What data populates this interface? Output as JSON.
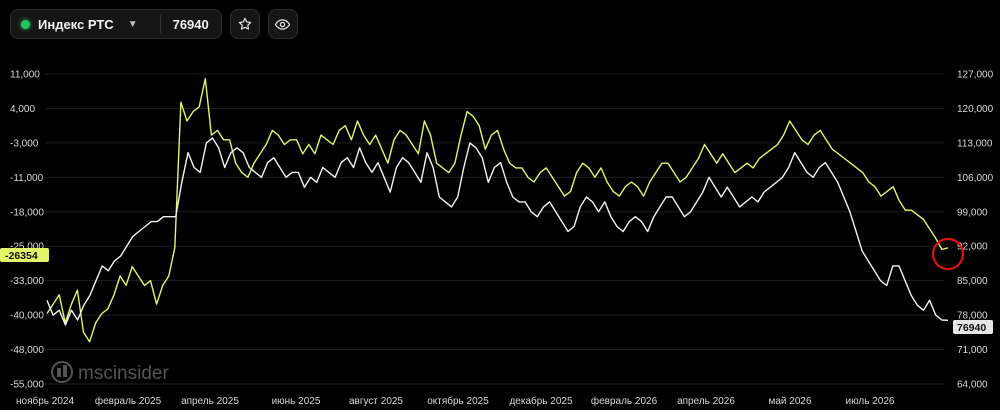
{
  "toolbar": {
    "ticker_name": "Индекс РТС",
    "ticker_value": "76940",
    "status_color": "#22c55e",
    "icons": [
      "chevron-down-icon",
      "star-icon",
      "eye-icon"
    ]
  },
  "watermark": "mscinsider",
  "chart_data": {
    "type": "line",
    "x_labels": [
      "ноябрь 2024",
      "февраль 2025",
      "апрель 2025",
      "июнь 2025",
      "август 2025",
      "октябрь 2025",
      "декабрь 2025",
      "февраль 2026",
      "апрель 2026",
      "май 2026",
      "июль 2026"
    ],
    "left_axis": {
      "ticks": [
        "11,000",
        "4,000",
        "-3,000",
        "-11,000",
        "-18,000",
        "-25,000",
        "-33,000",
        "-40,000",
        "-48,000",
        "-55,000"
      ],
      "range": [
        -55000,
        11000
      ]
    },
    "right_axis": {
      "ticks": [
        "127,000",
        "120,000",
        "113,000",
        "106,000",
        "99,000",
        "92,000",
        "85,000",
        "78,000",
        "71,000",
        "64,000"
      ],
      "range": [
        64000,
        127000
      ]
    },
    "left_badge": "-26354",
    "right_badge": "76940",
    "series": [
      {
        "color": "#e2f56b",
        "axis": "left",
        "values": [
          -40000,
          -38000,
          -36000,
          -42000,
          -38000,
          -35000,
          -44000,
          -46000,
          -42000,
          -40000,
          -39000,
          -36000,
          -32000,
          -34000,
          -30000,
          -32000,
          -34000,
          -33000,
          -38000,
          -34000,
          -32000,
          -26000,
          5000,
          1000,
          3000,
          4000,
          10000,
          -2000,
          -1000,
          -3000,
          -3000,
          -8000,
          -10000,
          -11000,
          -8000,
          -6000,
          -4000,
          -1000,
          -2000,
          -4000,
          -3000,
          -3000,
          -6000,
          -4000,
          -6000,
          -2000,
          -3000,
          -4000,
          -1000,
          0,
          -3000,
          1000,
          -2000,
          -4000,
          -2000,
          -5000,
          -8000,
          -3000,
          -1000,
          -2000,
          -4000,
          -6000,
          1000,
          -2000,
          -8000,
          -9000,
          -10000,
          -8000,
          -2000,
          3000,
          2000,
          0,
          -5000,
          -2000,
          -1000,
          -5000,
          -8000,
          -9000,
          -9000,
          -11000,
          -12000,
          -10000,
          -9000,
          -11000,
          -13000,
          -15000,
          -14000,
          -10000,
          -8000,
          -9000,
          -11000,
          -9000,
          -12000,
          -14000,
          -15000,
          -13000,
          -12000,
          -13000,
          -15000,
          -12000,
          -10000,
          -8000,
          -8000,
          -10000,
          -12000,
          -11000,
          -9000,
          -7000,
          -4000,
          -6000,
          -8000,
          -6000,
          -8000,
          -10000,
          -9000,
          -8000,
          -9000,
          -7000,
          -6000,
          -5000,
          -4000,
          -2000,
          1000,
          -1000,
          -3000,
          -4000,
          -2000,
          -1000,
          -3000,
          -5000,
          -6000,
          -7000,
          -8000,
          -9000,
          -10000,
          -12000,
          -13000,
          -15000,
          -14000,
          -13000,
          -16000,
          -18000,
          -18000,
          -19000,
          -20000,
          -22000,
          -24000,
          -26354,
          -26000
        ]
      },
      {
        "color": "#f2f2f2",
        "axis": "right",
        "values": [
          81000,
          78000,
          79000,
          76000,
          79000,
          77000,
          80000,
          82000,
          85000,
          88000,
          87000,
          89000,
          90000,
          92000,
          94000,
          95000,
          96000,
          97000,
          97000,
          98000,
          98000,
          98000,
          105000,
          111000,
          108000,
          107000,
          113000,
          114000,
          112000,
          108000,
          111000,
          112000,
          111000,
          108000,
          107000,
          106000,
          109000,
          110000,
          108000,
          106000,
          107000,
          107000,
          104000,
          106000,
          105000,
          108000,
          107000,
          106000,
          109000,
          110000,
          108000,
          112000,
          109000,
          107000,
          109000,
          106000,
          103000,
          108000,
          110000,
          109000,
          107000,
          105000,
          111000,
          108000,
          102000,
          101000,
          100000,
          102000,
          108000,
          113000,
          112000,
          110000,
          105000,
          108000,
          109000,
          105000,
          102000,
          101000,
          101000,
          99000,
          98000,
          100000,
          101000,
          99000,
          97000,
          95000,
          96000,
          100000,
          102000,
          101000,
          99000,
          101000,
          98000,
          96000,
          95000,
          97000,
          98000,
          97000,
          95000,
          98000,
          100000,
          102000,
          102000,
          100000,
          98000,
          99000,
          101000,
          103000,
          106000,
          104000,
          102000,
          104000,
          102000,
          100000,
          101000,
          102000,
          101000,
          103000,
          104000,
          105000,
          106000,
          108000,
          111000,
          109000,
          107000,
          106000,
          108000,
          109000,
          107000,
          105000,
          102000,
          99000,
          95000,
          91000,
          89000,
          87000,
          85000,
          84000,
          88000,
          88000,
          85000,
          82000,
          80000,
          79000,
          81000,
          78000,
          77000,
          76940
        ]
      }
    ]
  }
}
